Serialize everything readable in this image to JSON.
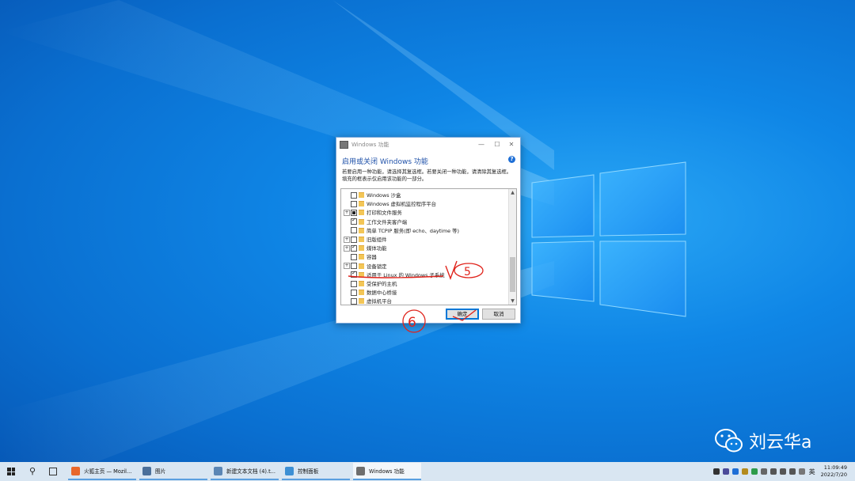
{
  "dialog": {
    "title": "Windows 功能",
    "heading": "启用或关闭 Windows 功能",
    "help": "?",
    "description": "若要启用一种功能，请选择其复选框。若要关闭一种功能，请清除其复选框。填充的框表示仅启用该功能的一部分。",
    "features": [
      {
        "label": "Windows 沙盒",
        "state": "unchecked",
        "expandable": false
      },
      {
        "label": "Windows 虚拟机监控程序平台",
        "state": "unchecked",
        "expandable": false
      },
      {
        "label": "打印和文件服务",
        "state": "partial",
        "expandable": true
      },
      {
        "label": "工作文件夹客户端",
        "state": "checked",
        "expandable": false
      },
      {
        "label": "简单 TCPIP 服务(即 echo、daytime 等)",
        "state": "unchecked",
        "expandable": false
      },
      {
        "label": "旧版组件",
        "state": "unchecked",
        "expandable": true
      },
      {
        "label": "媒体功能",
        "state": "checked",
        "expandable": true
      },
      {
        "label": "容器",
        "state": "unchecked",
        "expandable": false
      },
      {
        "label": "设备锁定",
        "state": "unchecked",
        "expandable": true
      },
      {
        "label": "适用于 Linux 的 Windows 子系统",
        "state": "checked",
        "expandable": false
      },
      {
        "label": "受保护的主机",
        "state": "unchecked",
        "expandable": false
      },
      {
        "label": "数据中心桥接",
        "state": "unchecked",
        "expandable": false
      },
      {
        "label": "虚拟机平台",
        "state": "unchecked",
        "expandable": false
      }
    ],
    "ok_label": "确定",
    "cancel_label": "取消",
    "title_buttons": {
      "min": "—",
      "max": "☐",
      "close": "✕"
    }
  },
  "annotations": {
    "step5": "5",
    "step6": "6"
  },
  "watermark": {
    "text": "刘云华a"
  },
  "taskbar": {
    "search_glyph": "⚲",
    "tasks": [
      {
        "label": "火狐主页 — Mozil...",
        "color": "#e8672b"
      },
      {
        "label": "图片",
        "color": "#4a6f9a"
      },
      {
        "label": "新建文本文档 (4).t...",
        "color": "#5b86b5"
      },
      {
        "label": "控制面板",
        "color": "#3c8fd4"
      },
      {
        "label": "Windows 功能",
        "color": "#6e6e6e"
      }
    ],
    "ime": "英",
    "time": "11:09:49",
    "date": "2022/7/20"
  },
  "colors": {
    "accent": "#0078d7",
    "annotation": "#e0231b"
  }
}
